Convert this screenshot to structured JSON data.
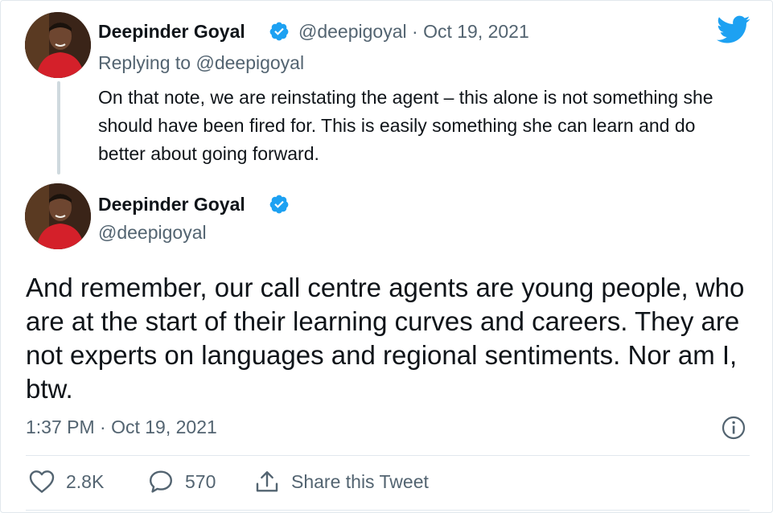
{
  "colors": {
    "brand_blue": "#1da1f2",
    "text": "#0f1419",
    "muted": "#536471",
    "thread_line": "#cfd9de"
  },
  "reply_tweet": {
    "author_name": "Deepinder Goyal",
    "author_handle": "@deepigoyal",
    "separator": " · ",
    "date": "Oct 19, 2021",
    "replying_to_prefix": "Replying to ",
    "replying_to_handle": "@deepigoyal",
    "text": "On that note, we are reinstating the agent – this alone is not something she should have been fired for. This is easily something she can learn and do better about going forward."
  },
  "main_tweet": {
    "author_name": "Deepinder Goyal",
    "author_handle": "@deepigoyal",
    "text": "And remember, our call centre agents are young people, who are at the start of their learning curves and careers. They are not experts on languages and regional sentiments. Nor am I, btw.",
    "timestamp": "1:37 PM · Oct 19, 2021"
  },
  "actions": {
    "like_count": "2.8K",
    "reply_count": "570",
    "share_label": "Share this Tweet"
  },
  "icons": {
    "logo": "twitter-bird-icon",
    "verified": "verified-badge-icon",
    "info": "info-icon",
    "like": "heart-icon",
    "reply": "speech-bubble-icon",
    "share": "share-icon"
  }
}
